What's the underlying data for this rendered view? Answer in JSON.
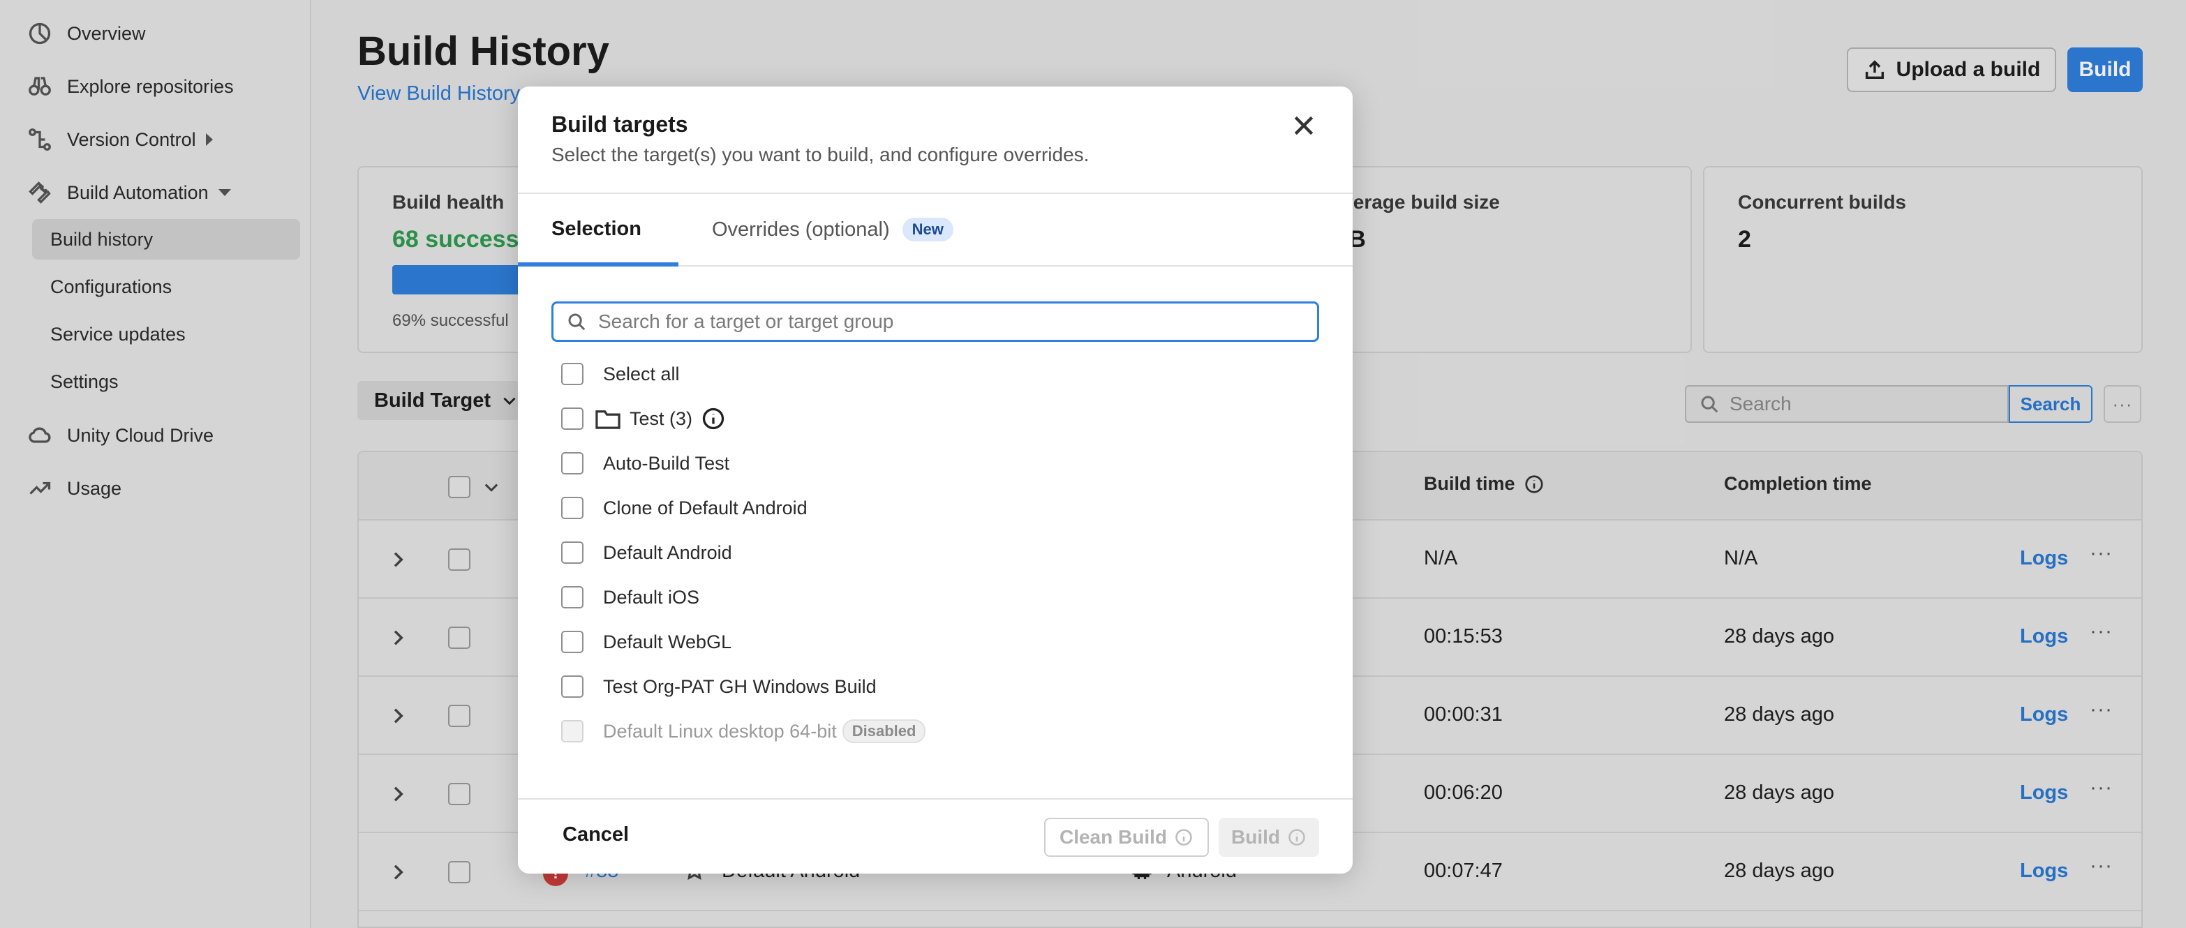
{
  "sidebar": {
    "items": [
      {
        "label": "Overview",
        "icon": "overview-icon"
      },
      {
        "label": "Explore repositories",
        "icon": "binoculars-icon"
      },
      {
        "label": "Version Control",
        "icon": "branch-icon"
      },
      {
        "label": "Build Automation",
        "icon": "wrench-icon"
      },
      {
        "label": "Unity Cloud Drive",
        "icon": "cloud-icon"
      },
      {
        "label": "Usage",
        "icon": "trend-icon"
      }
    ],
    "subitems": [
      "Build history",
      "Configurations",
      "Service updates",
      "Settings"
    ]
  },
  "header": {
    "title": "Build History",
    "view_link": "View Build History",
    "upload_label": "Upload a build",
    "build_label": "Build"
  },
  "cards": {
    "health_label": "Build health",
    "health_value": "68 successful",
    "health_fill": 0.69,
    "health_sub": "69% successful",
    "size_label": "Average build size",
    "size_value": "MB",
    "concurrent_label": "Concurrent builds",
    "concurrent_value": "2"
  },
  "filters": {
    "target_label": "Build Target",
    "search_placeholder": "Search",
    "search_button": "Search",
    "more": "···"
  },
  "table": {
    "headers": {
      "build_time": "Build time",
      "completion_time": "Completion time"
    },
    "logs_label": "Logs",
    "more": "···",
    "rows": [
      {
        "build_time": "N/A",
        "completion": "N/A"
      },
      {
        "build_time": "00:15:53",
        "completion": "28 days ago"
      },
      {
        "build_time": "00:00:31",
        "completion": "28 days ago"
      },
      {
        "build_time": "00:06:20",
        "completion": "28 days ago"
      },
      {
        "build_time": "00:07:47",
        "completion": "28 days ago",
        "number": "#88",
        "status": "!",
        "target": "Default Android",
        "platform": "Android"
      }
    ]
  },
  "modal": {
    "title": "Build targets",
    "subtitle": "Select the target(s) you want to build, and configure overrides.",
    "tabs": [
      {
        "label": "Selection"
      },
      {
        "label": "Overrides (optional)",
        "badge": "New"
      }
    ],
    "search_placeholder": "Search for a target or target group",
    "options": [
      {
        "label": "Select all"
      },
      {
        "label": "Test (3)"
      },
      {
        "label": "Auto-Build Test"
      },
      {
        "label": "Clone of Default Android"
      },
      {
        "label": "Default Android"
      },
      {
        "label": "Default iOS"
      },
      {
        "label": "Default WebGL"
      },
      {
        "label": "Test Org-PAT GH Windows Build"
      },
      {
        "label": "Default Linux desktop 64-bit",
        "badge": "Disabled"
      }
    ],
    "cancel_label": "Cancel",
    "clean_build_label": "Clean Build",
    "build_label": "Build"
  },
  "colors": {
    "accent": "#2f7fdc",
    "success": "#2e9b4f",
    "error": "#d33d3d"
  }
}
